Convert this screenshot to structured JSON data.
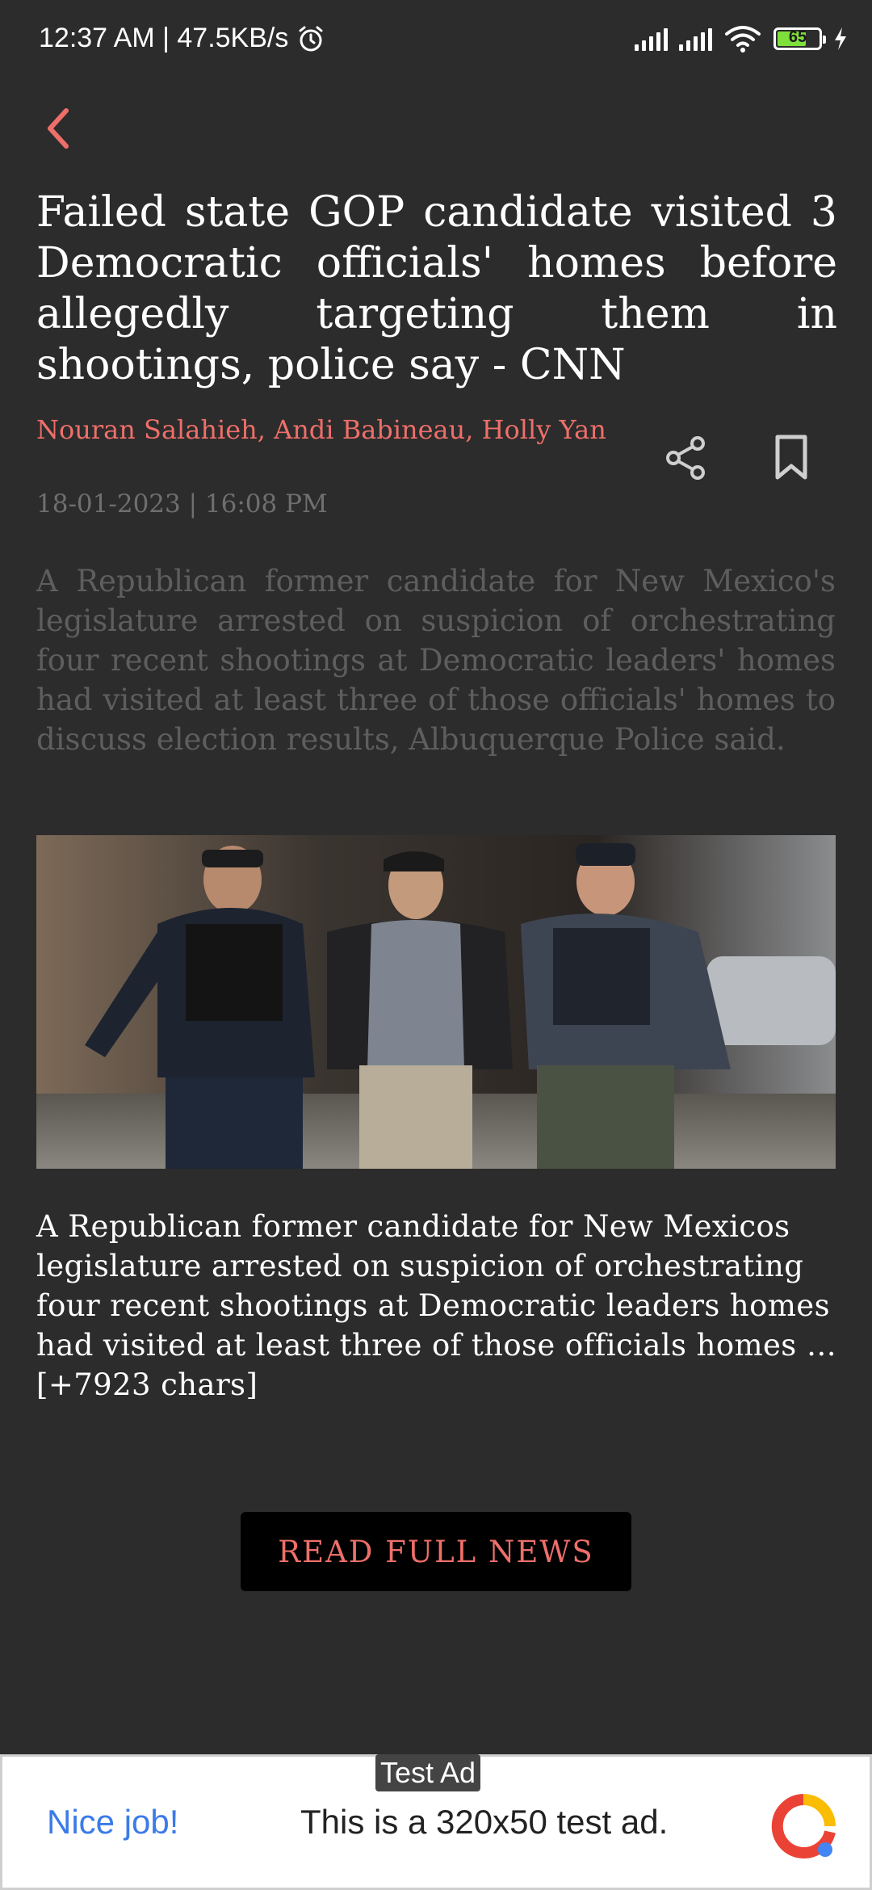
{
  "status_bar": {
    "time_speed": "12:37 AM | 47.5KB/s",
    "battery": "65"
  },
  "article": {
    "headline": "Failed state GOP candidate visited 3 Democratic officials' homes before allegedly targeting them in shootings, police say - CNN",
    "authors": "Nouran Salahieh, Andi Babineau, Holly Yan",
    "date": "18-01-2023 | 16:08 PM",
    "summary": "A Republican former candidate for New Mexico's legislature arrested on suspicion of orchestrating four recent shootings at Democratic leaders' homes had visited at least three of those officials' homes to discuss election results, Albuquerque Police said.",
    "content": "A Republican former candidate for New Mexicos legislature arrested on suspicion of orchestrating four recent shootings at Democratic leaders homes had visited at least three of those officials homes … [+7923 chars]",
    "read_full_label": "READ FULL NEWS"
  },
  "icons": {
    "back": "back-arrow-icon",
    "share": "share-icon",
    "bookmark": "bookmark-icon"
  },
  "ad": {
    "tag": "Test Ad",
    "nice": "Nice job!",
    "text": "This is a 320x50 test ad."
  },
  "colors": {
    "background": "#2c2c2c",
    "accent": "#ee6f6a",
    "muted": "#5e5e5e",
    "button_bg": "#000000"
  }
}
